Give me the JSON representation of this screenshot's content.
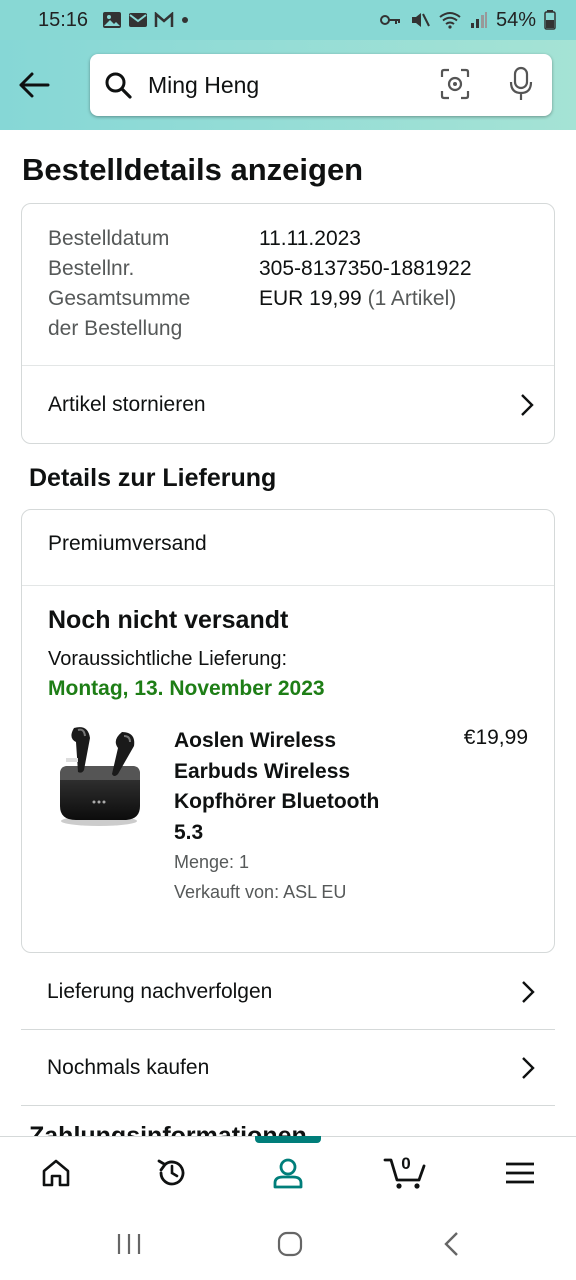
{
  "status_bar": {
    "time": "15:16",
    "battery": "54%"
  },
  "search": {
    "query": "Ming Heng"
  },
  "page": {
    "title": "Bestelldetails anzeigen"
  },
  "order_summary": {
    "date_label": "Bestelldatum",
    "date_value": "11.11.2023",
    "number_label": "Bestellnr.",
    "number_value": "305-8137350-1881922",
    "total_label_line1": "Gesamtsumme",
    "total_label_line2": "der Bestellung",
    "total_value": "EUR 19,99",
    "total_count": "(1 Artikel)",
    "cancel_label": "Artikel stornieren"
  },
  "delivery": {
    "section_title": "Details zur Lieferung",
    "shipping_type": "Premiumversand",
    "status": "Noch nicht versandt",
    "expected_label": "Voraussichtliche Lieferung:",
    "expected_date": "Montag, 13. November 2023",
    "product": {
      "title": "Aoslen Wireless Earbuds Wireless Kopfhörer Bluetooth 5.3",
      "price": "€19,99",
      "quantity": "Menge: 1",
      "seller": "Verkauft von: ASL EU"
    }
  },
  "actions": {
    "track": "Lieferung nachverfolgen",
    "buy_again": "Nochmals kaufen"
  },
  "partial_section_title": "Zahlungsinformationen",
  "bottom_nav": {
    "cart_count": "0",
    "active_tab": "account"
  },
  "colors": {
    "header_teal": "#86d7d6",
    "delivery_green": "#1e7e16",
    "nav_active": "#007e7a"
  }
}
